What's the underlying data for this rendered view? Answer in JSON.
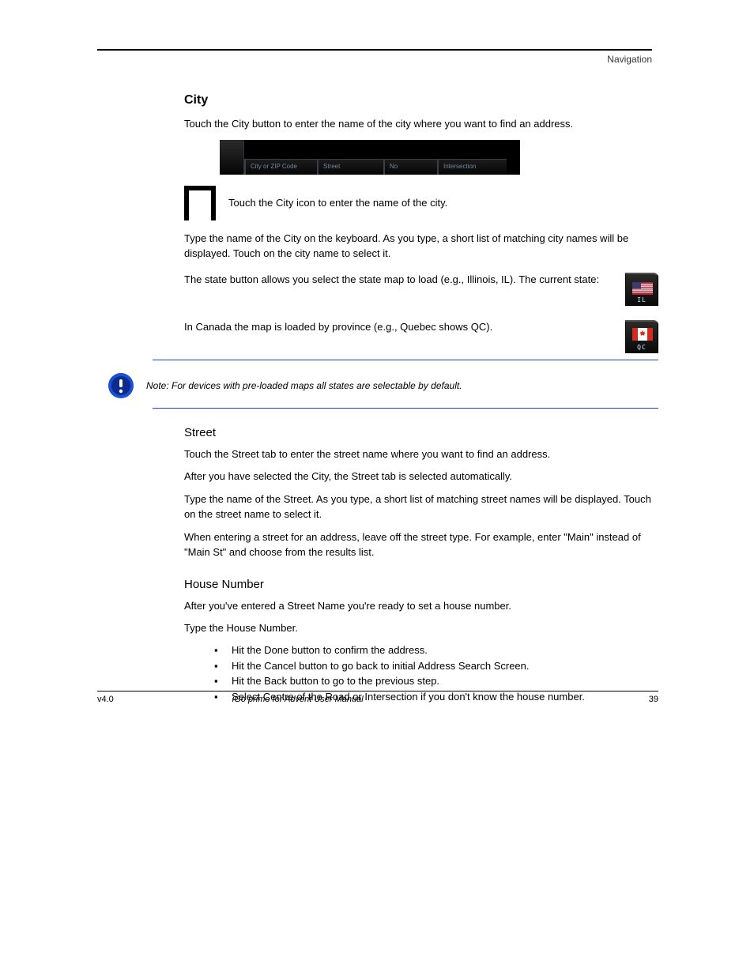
{
  "header": {
    "running": "Navigation"
  },
  "section": {
    "h_city": "City",
    "p_top": "Touch the City button to enter the name of the city where you want to find an address.",
    "tabs": {
      "t1": "City or ZIP Code",
      "t2": "Street",
      "t3": "No",
      "t4": "Intersection"
    },
    "city_icon_text": "Touch the City icon to enter the name of the city.",
    "type_city": "Type the name of the City on the keyboard.  As you type, a short list of matching city names will be displayed.  Touch on the city name to select it.",
    "us_row_text": "The state button allows you select the state map to load (e.g., Illinois, IL). The current state:",
    "ca_row_text": "In Canada the map is loaded by province (e.g., Quebec shows QC).",
    "flag_us_label": "IL",
    "flag_ca_label": "QC",
    "note": "Note: For devices with pre-loaded maps all states are selectable by default.",
    "h_street": "Street",
    "p_street_1": "Touch the Street tab to enter the street name where you want to find an address.",
    "p_street_2": "After you have selected the City, the Street tab is selected automatically.",
    "p_street_3": "Type the name of the Street. As you type, a short list of matching street names will be displayed. Touch on the street name to select it.",
    "p_street_4": "When entering a street for an address, leave off the street type. For example, enter \"Main\" instead of \"Main St\" and choose from the results list.",
    "h_house": "House Number",
    "p_house_1": "After you've entered a Street Name you're ready to set a house number.",
    "p_house_2": "Type the House Number.",
    "steps": [
      "Hit the Done button to confirm the address.",
      "Hit the Cancel button to go back to initial Address Search Screen.",
      "Hit the Back button to go to the previous step.",
      "Select Centre of the Road or Intersection if you don't know the house number."
    ]
  },
  "footer": {
    "left": "v4.0",
    "center": "iGo primo for Advent User Manual",
    "right": "39"
  }
}
